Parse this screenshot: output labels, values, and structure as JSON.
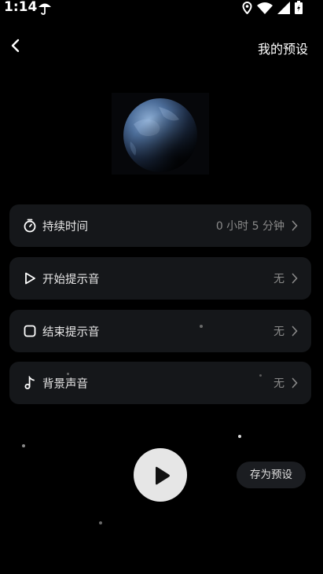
{
  "status_bar": {
    "time": "1:14"
  },
  "header": {
    "presets_label": "我的预设"
  },
  "settings": [
    {
      "label": "持续时间",
      "value": "0 小时 5 分钟",
      "icon": "timer-icon"
    },
    {
      "label": "开始提示音",
      "value": "无",
      "icon": "play-outline-icon"
    },
    {
      "label": "结束提示音",
      "value": "无",
      "icon": "stop-outline-icon"
    },
    {
      "label": "背景声音",
      "value": "无",
      "icon": "music-note-icon"
    }
  ],
  "actions": {
    "save_preset_label": "存为预设"
  },
  "colors": {
    "background": "#000000",
    "card": "#15171a",
    "play_button": "#e6e6e6"
  }
}
